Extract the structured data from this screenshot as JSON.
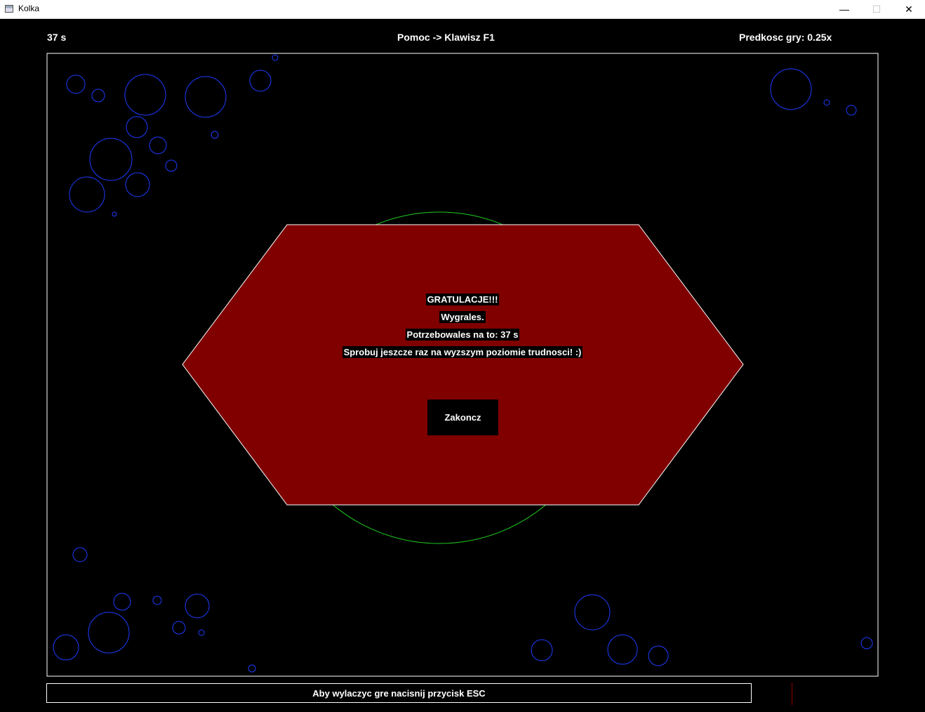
{
  "window": {
    "title": "Kolka",
    "minimize_glyph": "—",
    "maximize_glyph": "☐",
    "close_glyph": "✕"
  },
  "hud": {
    "time": "37 s",
    "help": "Pomoc -> Klawisz F1",
    "speed": "Predkosc gry: 0.25x"
  },
  "dialog": {
    "line1": "GRATULACJE!!!",
    "line2": "Wygrales.",
    "line3": "Potrzebowales na to: 37 s",
    "line4": "Sprobuj jeszcze raz na wyzszym poziomie trudnosci! :)",
    "button_label": "Zakoncz",
    "fill_color": "#800000"
  },
  "footer": {
    "text": "Aby wylaczyc gre nacisnij przycisk ESC"
  },
  "colors": {
    "circle": "#1e3cff",
    "target_circle": "#1fcc1f",
    "border": "#ffffff"
  }
}
